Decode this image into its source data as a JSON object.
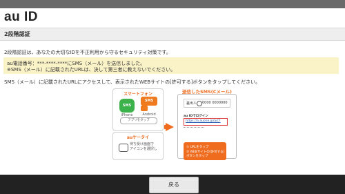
{
  "header": {
    "brand": "au ID"
  },
  "section": {
    "title": "2段階認証"
  },
  "intro": "2段階認証は、あなたの大切なIDを不正利用から守るセキュリティ対策です。",
  "notice": {
    "line1": "au電話番号：***-****-****にSMS（メール）を送信しました。",
    "line2": "※SMS（メール）に記載されたURLは、決して第三者に教えないでください。"
  },
  "instruction": "SMS（メール）に記載されたURLにアクセスして、表示されたWEBサイトの[許可する]ボタンをタップしてください。",
  "illustration": {
    "smartphone_title": "スマートフォン",
    "sms_label_green": "SMS",
    "sms_label_orange": "SMS",
    "iphone_label": "iPhone",
    "android_label": "Android",
    "app_tap_label": "アプリをタップ",
    "keitai_title": "auケータイ",
    "keitai_note": "待ち受け画面で アイコンを選択し",
    "sent_sms_title": "送信したSMS(Cメール)",
    "sender_label": "差出人",
    "sender_number": "0000 0000000",
    "login_label": "au IDでログイン",
    "url_text": "https://a.auone.jp/a/c?",
    "step1": "① URLをタップ",
    "step2": "② WEBサイトの[許可する]ボタンをタップ"
  },
  "footer": {
    "back_label": "戻る"
  },
  "colors": {
    "accent": "#ef6c1f",
    "notice_bg": "#fbf3c8",
    "footer_bg": "#222222"
  }
}
